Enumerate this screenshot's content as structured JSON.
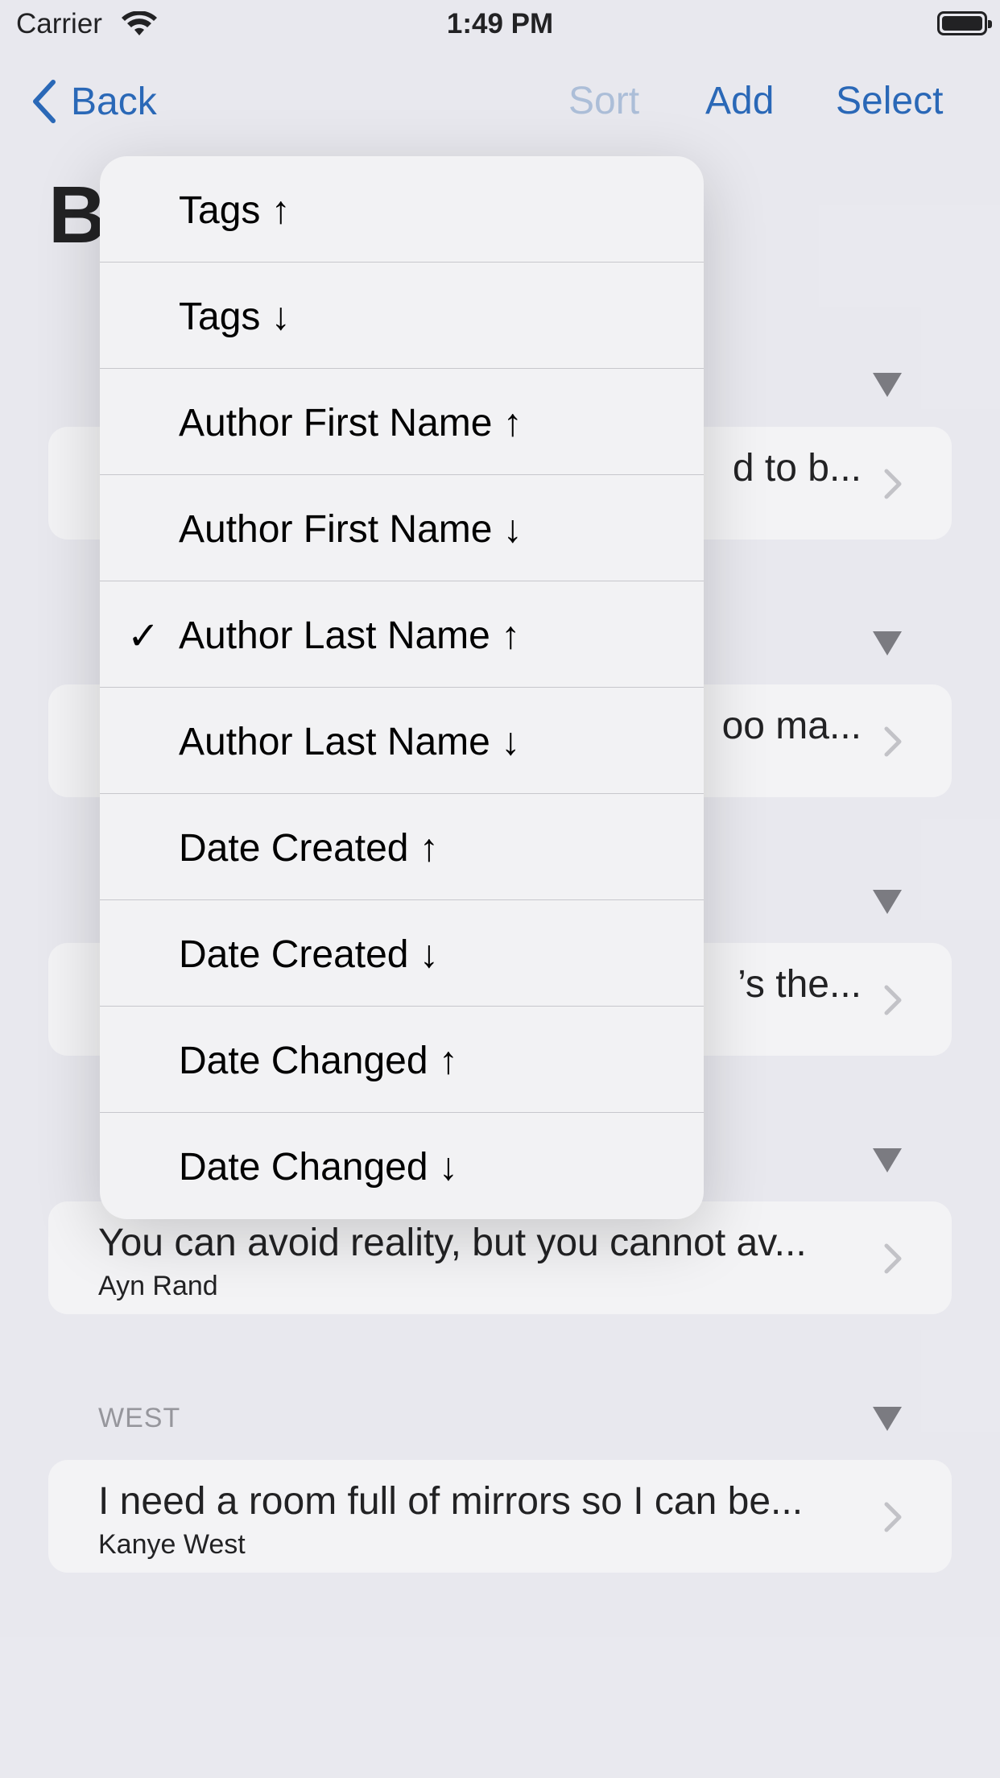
{
  "status_bar": {
    "carrier": "Carrier",
    "time": "1:49 PM"
  },
  "nav": {
    "back_label": "Back",
    "sort_label": "Sort",
    "add_label": "Add",
    "select_label": "Select"
  },
  "title_partial": "B",
  "sections": [
    {
      "header": "",
      "quote": "d to b...",
      "author": ""
    },
    {
      "header": "",
      "quote": "oo ma...",
      "author": ""
    },
    {
      "header": "",
      "quote": "’s the...",
      "author": ""
    },
    {
      "header": "",
      "quote": "You can avoid reality, but you cannot av...",
      "author": "Ayn Rand"
    },
    {
      "header": "WEST",
      "quote": "I need a room full of mirrors so I can be...",
      "author": "Kanye West"
    }
  ],
  "sort_menu": {
    "selected_index": 4,
    "checkmark": "✓",
    "items": [
      "Tags ↑",
      "Tags ↓",
      "Author First Name ↑",
      "Author First Name ↓",
      "Author Last Name ↑",
      "Author Last Name ↓",
      "Date Created ↑",
      "Date Created ↓",
      "Date Changed ↑",
      "Date Changed ↓"
    ]
  },
  "colors": {
    "accent": "#0a56b4",
    "disabled": "#a9bfdc",
    "background": "#f2f2f7"
  },
  "icons": [
    "wifi-icon",
    "battery-icon",
    "back-chevron-icon",
    "disclosure-chevron-icon",
    "collapse-triangle-icon",
    "checkmark-icon"
  ]
}
